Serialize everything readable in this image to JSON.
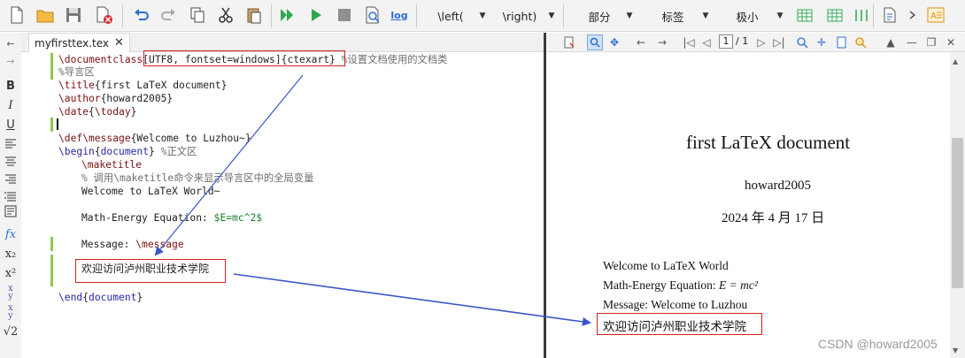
{
  "toolbar": {
    "dropdowns": [
      {
        "label": "\\left(",
        "id": "left-delim"
      },
      {
        "label": "\\right)",
        "id": "right-delim"
      },
      {
        "label": "部分",
        "id": "sectioning"
      },
      {
        "label": "标签",
        "id": "refs"
      },
      {
        "label": "极小",
        "id": "size"
      }
    ],
    "log_label": "log"
  },
  "editor": {
    "tab_name": "myfirsttex.tex",
    "tab_close": "✕",
    "lines": {
      "l1_cmd": "\\documentclass",
      "l1_opts": "[UTF8, fontset=windows]{ctexart}",
      "l1_cmt": " %设置文档使用的文档类",
      "l2_cmt": "%导言区",
      "l3_cmd": "\\title",
      "l3_arg": "{first LaTeX document}",
      "l4_cmd": "\\author",
      "l4_arg": "{howard2005}",
      "l5_cmd": "\\date",
      "l5_arg": "{",
      "l5_cmd2": "\\today",
      "l5_end": "}",
      "l7_cmd": "\\def\\message",
      "l7_arg": "{Welcome to Luzhou~}",
      "l8_cmd": "\\begin",
      "l8_arg1": "{",
      "l8_env": "document",
      "l8_arg2": "}",
      "l8_cmt": " %正文区",
      "l9_cmd": "\\maketitle",
      "l10_cmt": "% 调用\\maketitle命令来显示导言区中的全局变量",
      "l11_text": "Welcome to LaTeX World~",
      "l13_text": "Math-Energy Equation: ",
      "l13_math": "$E=mc^2$",
      "l15_text": "Message: ",
      "l15_cmd": "\\message",
      "l17_text": "欢迎访问泸州职业技术学院",
      "l19_cmd": "\\end",
      "l19_arg1": "{",
      "l19_env": "document",
      "l19_arg2": "}"
    }
  },
  "preview": {
    "page_current": "1",
    "page_total": "/ 1",
    "title": "first LaTeX document",
    "author": "howard2005",
    "date": "2024 年 4 月 17 日",
    "body": {
      "welcome": "Welcome to LaTeX World",
      "equation_label": "Math-Energy Equation: ",
      "equation": "E = mc²",
      "message": "Message: Welcome to Luzhou",
      "chinese": "欢迎访问泸州职业技术学院"
    }
  },
  "side_icons": [
    "B",
    "I",
    "U",
    "fx",
    "x₂",
    "x²",
    "√2"
  ],
  "watermark": "CSDN @howard2005",
  "colors": {
    "arrow": "#3a57c8",
    "annotation_box": "#d62020",
    "current_line": "#ececff",
    "change_marker": "#8cc84b"
  }
}
